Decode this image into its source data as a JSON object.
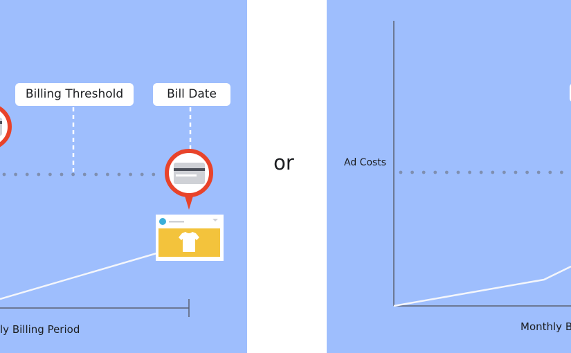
{
  "left_panel": {
    "threshold_label": "Billing Threshold",
    "bill_date_label": "Bill Date",
    "x_axis_label_visible": "ly Billing Period"
  },
  "separator_text": "or",
  "right_panel": {
    "y_axis_label": "Ad Costs",
    "x_axis_label_visible": "Monthly B"
  },
  "colors": {
    "background": "#9ebefd",
    "pin_red": "#e8432a",
    "card_gray": "#cfd1d6",
    "card_stripe": "#4b4f58",
    "ad_yellow": "#f3c33c",
    "avatar_blue": "#3aaed8",
    "dots": "#7f8fb0",
    "axis": "#5b6172"
  },
  "icons": [
    "credit-card-icon",
    "tshirt-icon",
    "map-pin-icon"
  ]
}
